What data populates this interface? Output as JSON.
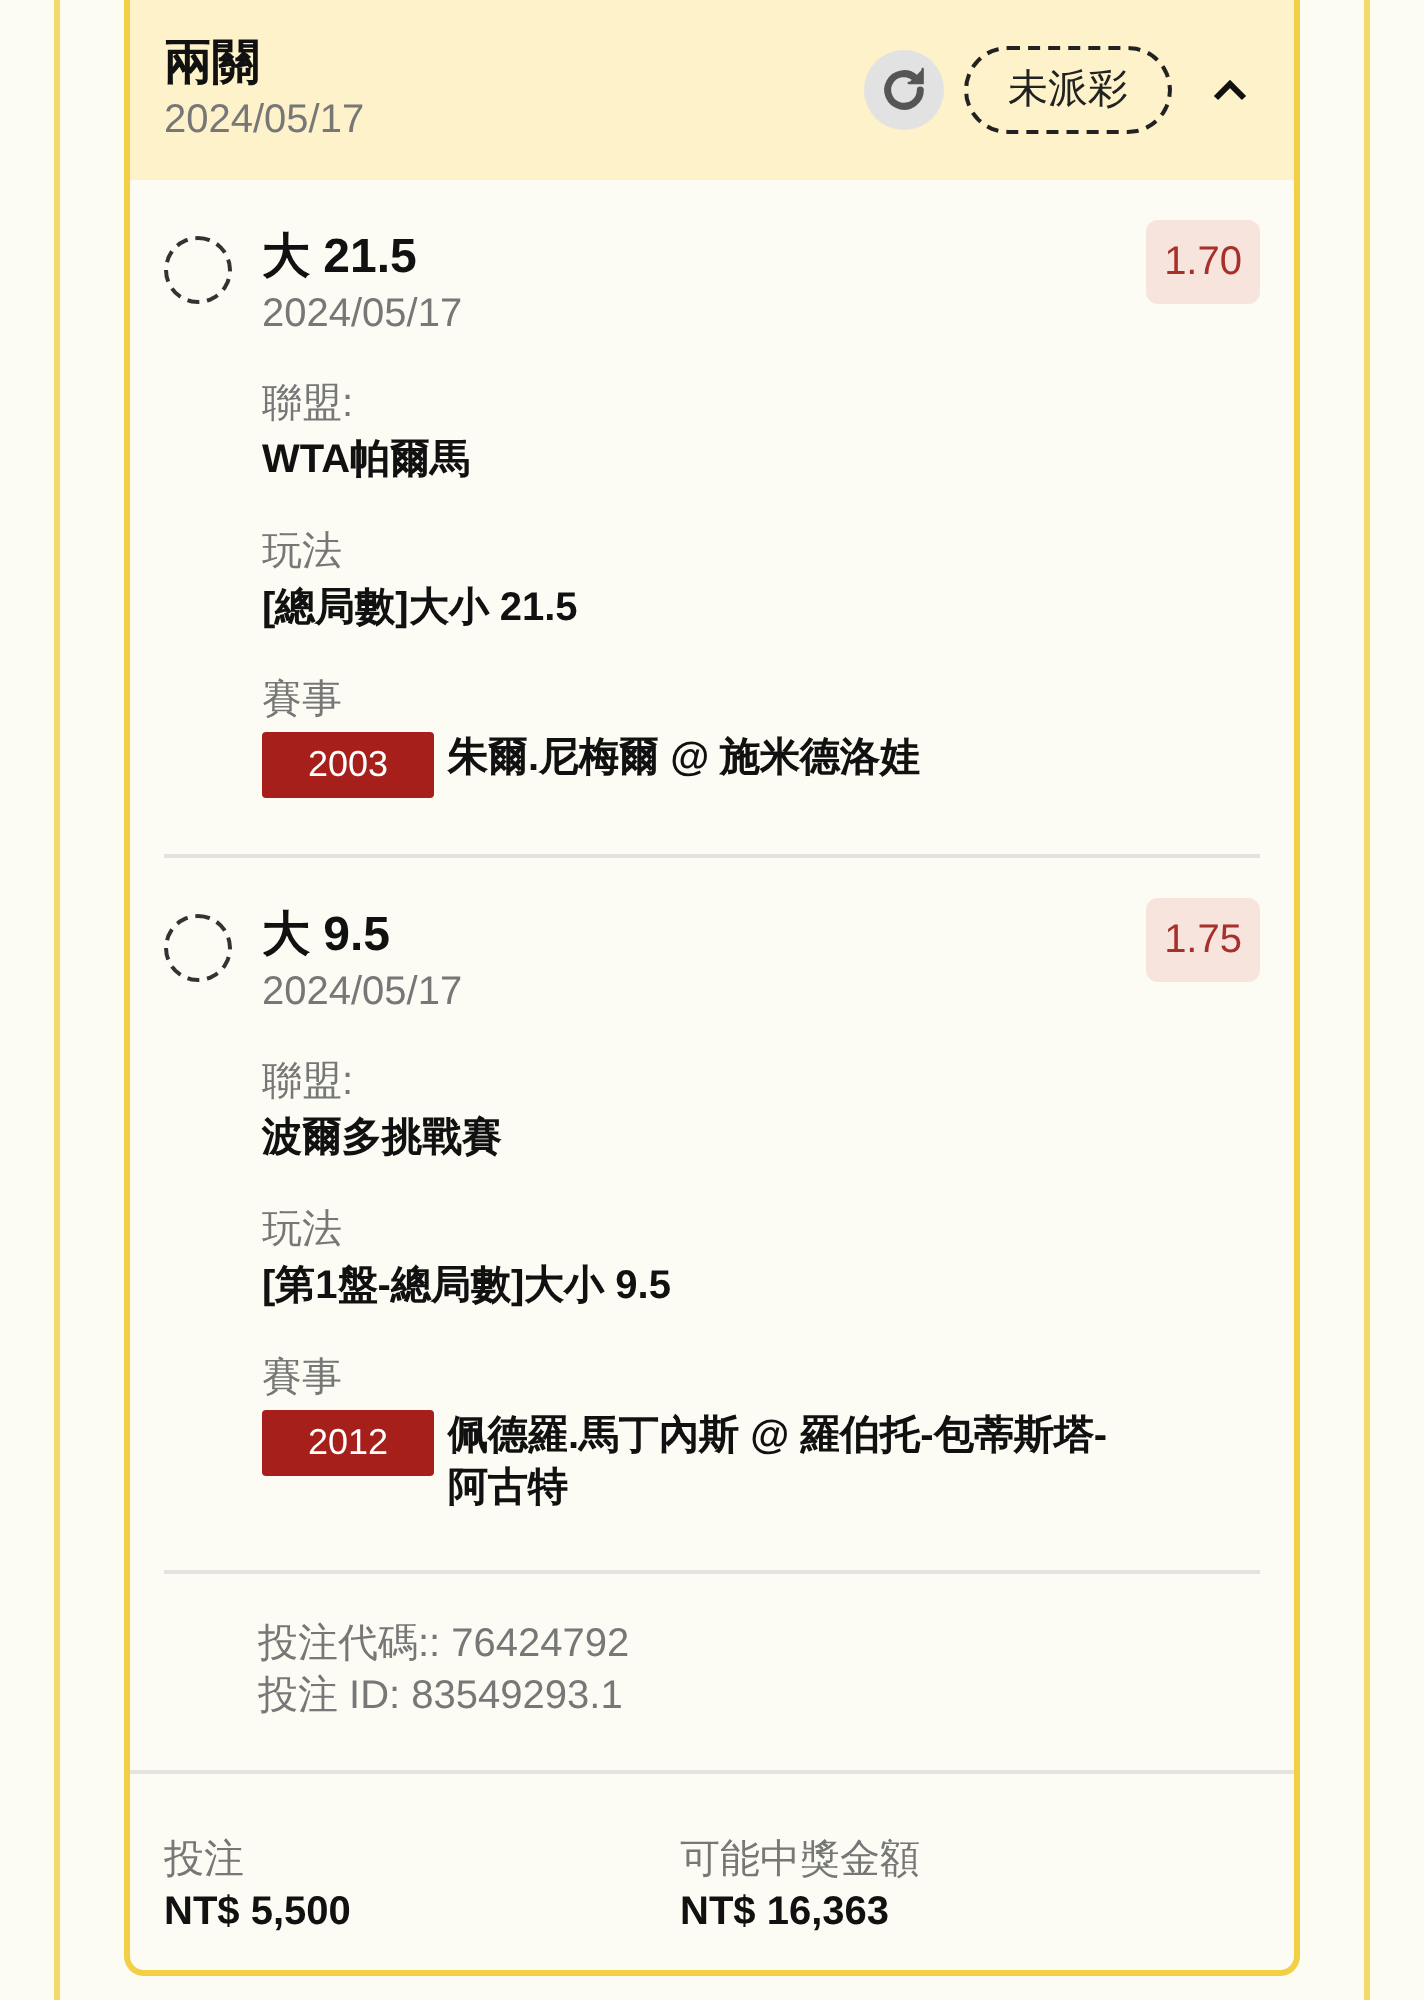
{
  "header": {
    "title": "兩關",
    "date": "2024/05/17",
    "status": "未派彩",
    "expanded": true
  },
  "legs": [
    {
      "selection": "大 21.5",
      "date": "2024/05/17",
      "odds": "1.70",
      "fields": [
        {
          "label": "聯盟:",
          "value": "WTA帕爾馬"
        },
        {
          "label": "玩法",
          "value": "[總局數]大小 21.5"
        }
      ],
      "event_label": "賽事",
      "event_code": "2003",
      "event_name": "朱爾.尼梅爾 @ 施米德洛娃"
    },
    {
      "selection": "大 9.5",
      "date": "2024/05/17",
      "odds": "1.75",
      "fields": [
        {
          "label": "聯盟:",
          "value": "波爾多挑戰賽"
        },
        {
          "label": "玩法",
          "value": "[第1盤-總局數]大小 9.5"
        }
      ],
      "event_label": "賽事",
      "event_code": "2012",
      "event_name": "佩德羅.馬丁內斯 @ 羅伯托-包蒂斯塔-阿古特"
    }
  ],
  "bet_code": "投注代碼:: 76424792",
  "bet_id": "投注 ID: 83549293.1",
  "footer": [
    {
      "label": "投注",
      "value": "NT$ 5,500"
    },
    {
      "label": "可能中獎金額",
      "value": "NT$ 16,363"
    }
  ]
}
